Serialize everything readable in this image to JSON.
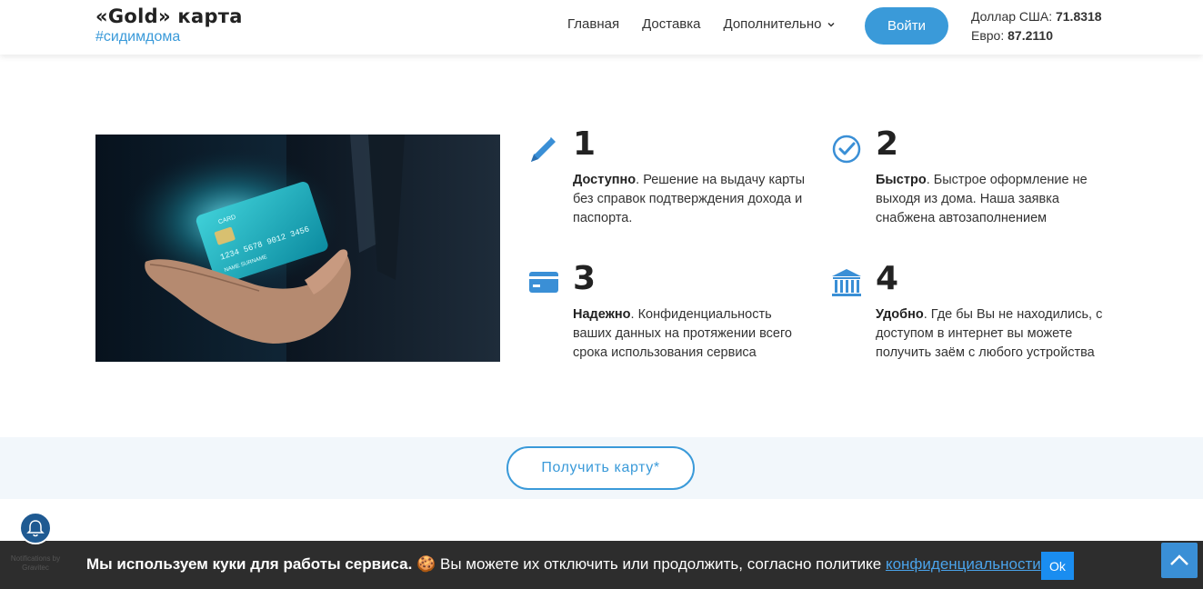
{
  "header": {
    "brand_title": "«Gold» карта",
    "brand_tag": "#сидимдома",
    "nav": [
      {
        "label": "Главная"
      },
      {
        "label": "Доставка"
      },
      {
        "label": "Дополнительно"
      }
    ],
    "login_label": "Войти",
    "rates": {
      "usd_label": "Доллар США:",
      "usd_value": "71.8318",
      "eur_label": "Евро:",
      "eur_value": "87.2110"
    }
  },
  "features": [
    {
      "num": "1",
      "title": "Доступно",
      "text": ". Решение на выдачу карты без справок подтверждения дохода и паспорта.",
      "icon": "pencil-icon"
    },
    {
      "num": "2",
      "title": "Быстро",
      "text": ". Быстрое оформление не выходя из дома. Наша заявка снабжена автозаполнением",
      "icon": "check-circle-icon"
    },
    {
      "num": "3",
      "title": "Надежно",
      "text": ". Конфиденциальность ваших данных на протяжении всего срока использования сервиса",
      "icon": "credit-card-icon"
    },
    {
      "num": "4",
      "title": "Удобно",
      "text": ". Где бы Вы не находились, с доступом в интернет вы можете получить заём с любого устройства",
      "icon": "bank-icon"
    }
  ],
  "hero_card": {
    "label": "CARD",
    "number": "1234  5678  9012  3456",
    "name": "NAME SURNAME"
  },
  "cta": {
    "label": "Получить карту*"
  },
  "cookie": {
    "bold_text": "Мы используем куки для работы сервиса.",
    "emoji": "🍪",
    "text": " Вы можете их отключить или продолжить, согласно политике ",
    "link_text": "конфиденциальности",
    "ok_label": "Ok"
  },
  "gravitec": {
    "label": "Notifications by Gravitec"
  },
  "colors": {
    "accent": "#3a9ad9",
    "cookie_bg": "#2d2d2d",
    "cta_band_bg": "#f2f7fb",
    "ok_button": "#1a8df0"
  }
}
